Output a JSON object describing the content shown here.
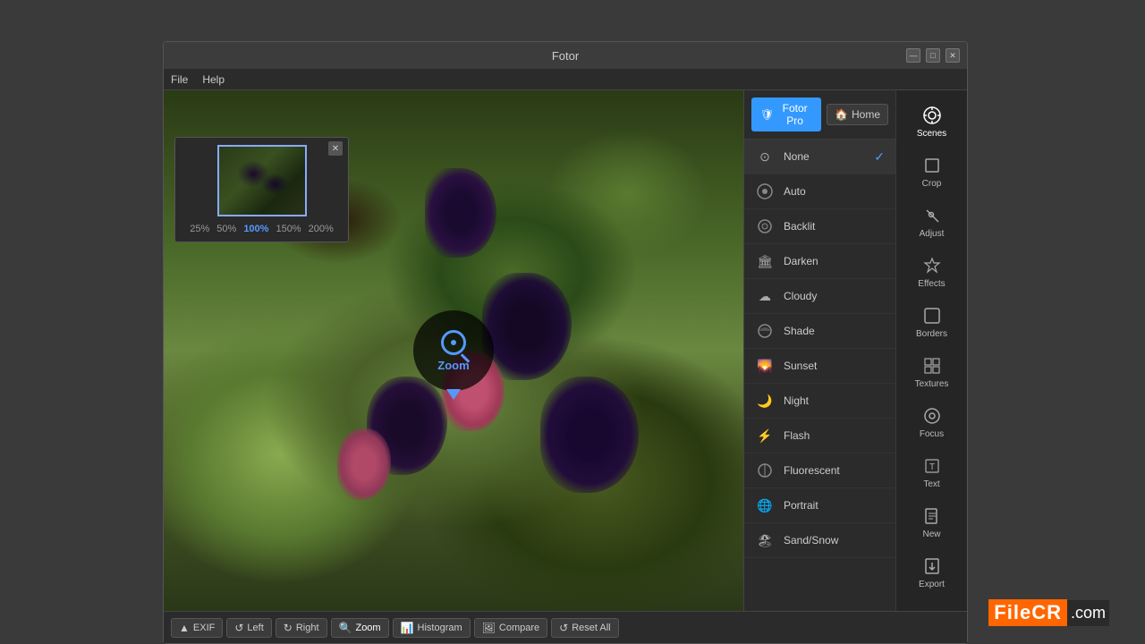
{
  "window": {
    "title": "Fotor",
    "controls": {
      "minimize": "—",
      "maximize": "□",
      "close": "✕"
    }
  },
  "menu": {
    "items": [
      "File",
      "Help"
    ]
  },
  "header": {
    "fotor_pro_label": "Fotor Pro",
    "home_label": "Home",
    "home_icon": "🏠",
    "shield_icon": "🛡"
  },
  "scenes": {
    "items": [
      {
        "id": "none",
        "name": "None",
        "icon": "⊙",
        "selected": true
      },
      {
        "id": "auto",
        "name": "Auto",
        "icon": "📷"
      },
      {
        "id": "backlit",
        "name": "Backlit",
        "icon": "📷"
      },
      {
        "id": "darken",
        "name": "Darken",
        "icon": "🏛"
      },
      {
        "id": "cloudy",
        "name": "Cloudy",
        "icon": "☁"
      },
      {
        "id": "shade",
        "name": "Shade",
        "icon": "📷"
      },
      {
        "id": "sunset",
        "name": "Sunset",
        "icon": "🌄"
      },
      {
        "id": "night",
        "name": "Night",
        "icon": "🌙"
      },
      {
        "id": "flash",
        "name": "Flash",
        "icon": "⚡"
      },
      {
        "id": "fluorescent",
        "name": "Fluorescent",
        "icon": "📷"
      },
      {
        "id": "portrait",
        "name": "Portrait",
        "icon": "🌐"
      },
      {
        "id": "sand_snow",
        "name": "Sand/Snow",
        "icon": "🏖"
      }
    ]
  },
  "tools": [
    {
      "id": "scenes",
      "label": "Scenes",
      "icon": "✦",
      "active": true
    },
    {
      "id": "crop",
      "label": "Crop",
      "icon": "⊡"
    },
    {
      "id": "adjust",
      "label": "Adjust",
      "icon": "✏"
    },
    {
      "id": "effects",
      "label": "Effects",
      "icon": "✦"
    },
    {
      "id": "borders",
      "label": "Borders",
      "icon": "▢"
    },
    {
      "id": "textures",
      "label": "Textures",
      "icon": "⊞"
    },
    {
      "id": "focus",
      "label": "Focus",
      "icon": "◎"
    },
    {
      "id": "text",
      "label": "Text",
      "icon": "T"
    },
    {
      "id": "new",
      "label": "New",
      "icon": "📄"
    },
    {
      "id": "export",
      "label": "Export",
      "icon": "↗"
    }
  ],
  "thumbnail": {
    "close": "✕",
    "zoom_levels": [
      "25%",
      "50%",
      "100%",
      "150%",
      "200%"
    ],
    "active_zoom": "100%"
  },
  "bottom_bar": {
    "buttons": [
      {
        "id": "exif",
        "label": "EXIF",
        "icon": "▲",
        "special": true
      },
      {
        "id": "left",
        "label": "Left",
        "icon": "↺"
      },
      {
        "id": "right",
        "label": "Right",
        "icon": "↻"
      },
      {
        "id": "zoom",
        "label": "Zoom",
        "icon": "🔍",
        "active": true
      },
      {
        "id": "histogram",
        "label": "Histogram",
        "icon": "📊"
      },
      {
        "id": "compare",
        "label": "Compare",
        "icon": "🖼"
      },
      {
        "id": "reset_all",
        "label": "Reset All",
        "icon": "↺"
      }
    ]
  },
  "zoom_indicator": {
    "label": "Zoom"
  },
  "watermark": {
    "text": "FileCR",
    "dot": ".com"
  }
}
